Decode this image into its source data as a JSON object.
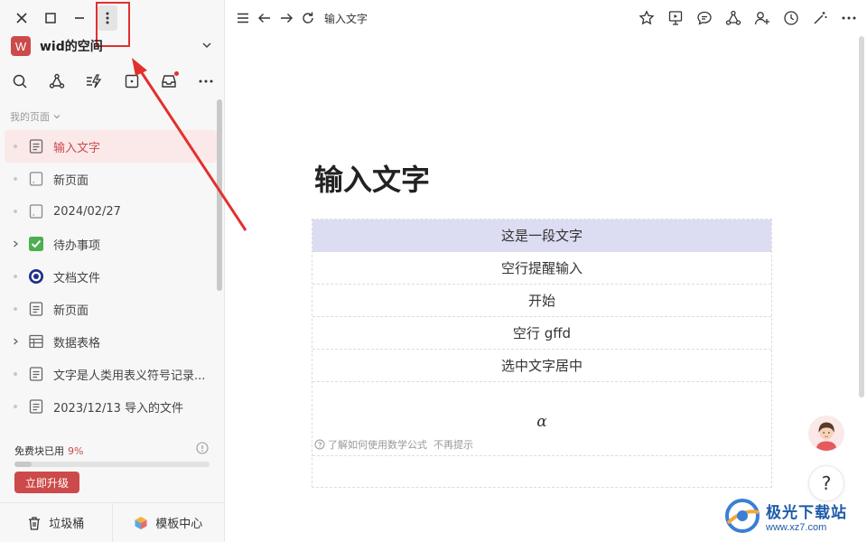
{
  "sidebar": {
    "workspace": {
      "avatar_letter": "W",
      "name": "wid的空间"
    },
    "section_label": "我的页面",
    "pages": [
      {
        "label": "输入文字",
        "icon": "doc-icon",
        "active": true,
        "expandable": false
      },
      {
        "label": "新页面",
        "icon": "blank-page-icon",
        "active": false,
        "expandable": false
      },
      {
        "label": "2024/02/27",
        "icon": "blank-page-icon",
        "active": false,
        "expandable": false
      },
      {
        "label": "待办事项",
        "icon": "checkbox-icon",
        "active": false,
        "expandable": true
      },
      {
        "label": "文档文件",
        "icon": "target-icon",
        "active": false,
        "expandable": false
      },
      {
        "label": "新页面",
        "icon": "doc-icon",
        "active": false,
        "expandable": false
      },
      {
        "label": "数据表格",
        "icon": "table-icon",
        "active": false,
        "expandable": true
      },
      {
        "label": "文字是人类用表义符号记录...",
        "icon": "doc-icon",
        "active": false,
        "expandable": false
      },
      {
        "label": "2023/12/13 导入的文件",
        "icon": "doc-icon",
        "active": false,
        "expandable": false
      }
    ],
    "quota": {
      "label": "免费块已用",
      "percent_text": "9%",
      "percent": 9,
      "upgrade_label": "立即升级"
    },
    "bottom": {
      "trash_label": "垃圾桶",
      "templates_label": "模板中心"
    }
  },
  "main": {
    "breadcrumb_title": "输入文字",
    "heading": "输入文字",
    "table_rows": [
      "这是一段文字",
      "空行提醒输入",
      "开始",
      "空行 gffd",
      "选中文字居中"
    ],
    "formula": {
      "symbol": "α",
      "hint": "了解如何使用数学公式",
      "dismiss": "不再提示"
    }
  },
  "help_label": "?",
  "watermark": {
    "title": "极光下载站",
    "url": "www.xz7.com"
  },
  "colors": {
    "accent": "#cc4a4a",
    "selection": "#dcdcf2",
    "annotation": "#e2302d"
  }
}
